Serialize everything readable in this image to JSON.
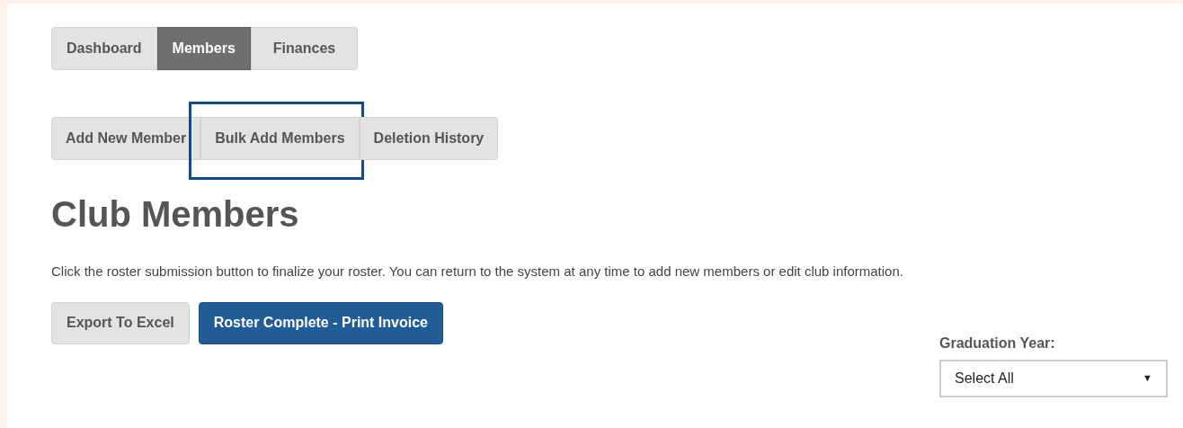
{
  "nav_tabs": [
    {
      "label": "Dashboard",
      "selected": false
    },
    {
      "label": "Members",
      "selected": true
    },
    {
      "label": "Finances",
      "selected": false
    }
  ],
  "sub_tabs": [
    {
      "label": "Add New Member",
      "highlighted": false
    },
    {
      "label": "Bulk Add Members",
      "highlighted": true
    },
    {
      "label": "Deletion History",
      "highlighted": false
    }
  ],
  "heading": "Club Members",
  "description": "Click the roster submission button to finalize your roster. You can return to the system at any time to add new members or edit club information.",
  "buttons": [
    {
      "label": "Export To Excel",
      "kind": "secondary"
    },
    {
      "label": "Roster Complete - Print Invoice",
      "kind": "primary"
    }
  ],
  "filter": {
    "label": "Graduation Year:",
    "value": "Select All",
    "arrow": "▼"
  }
}
